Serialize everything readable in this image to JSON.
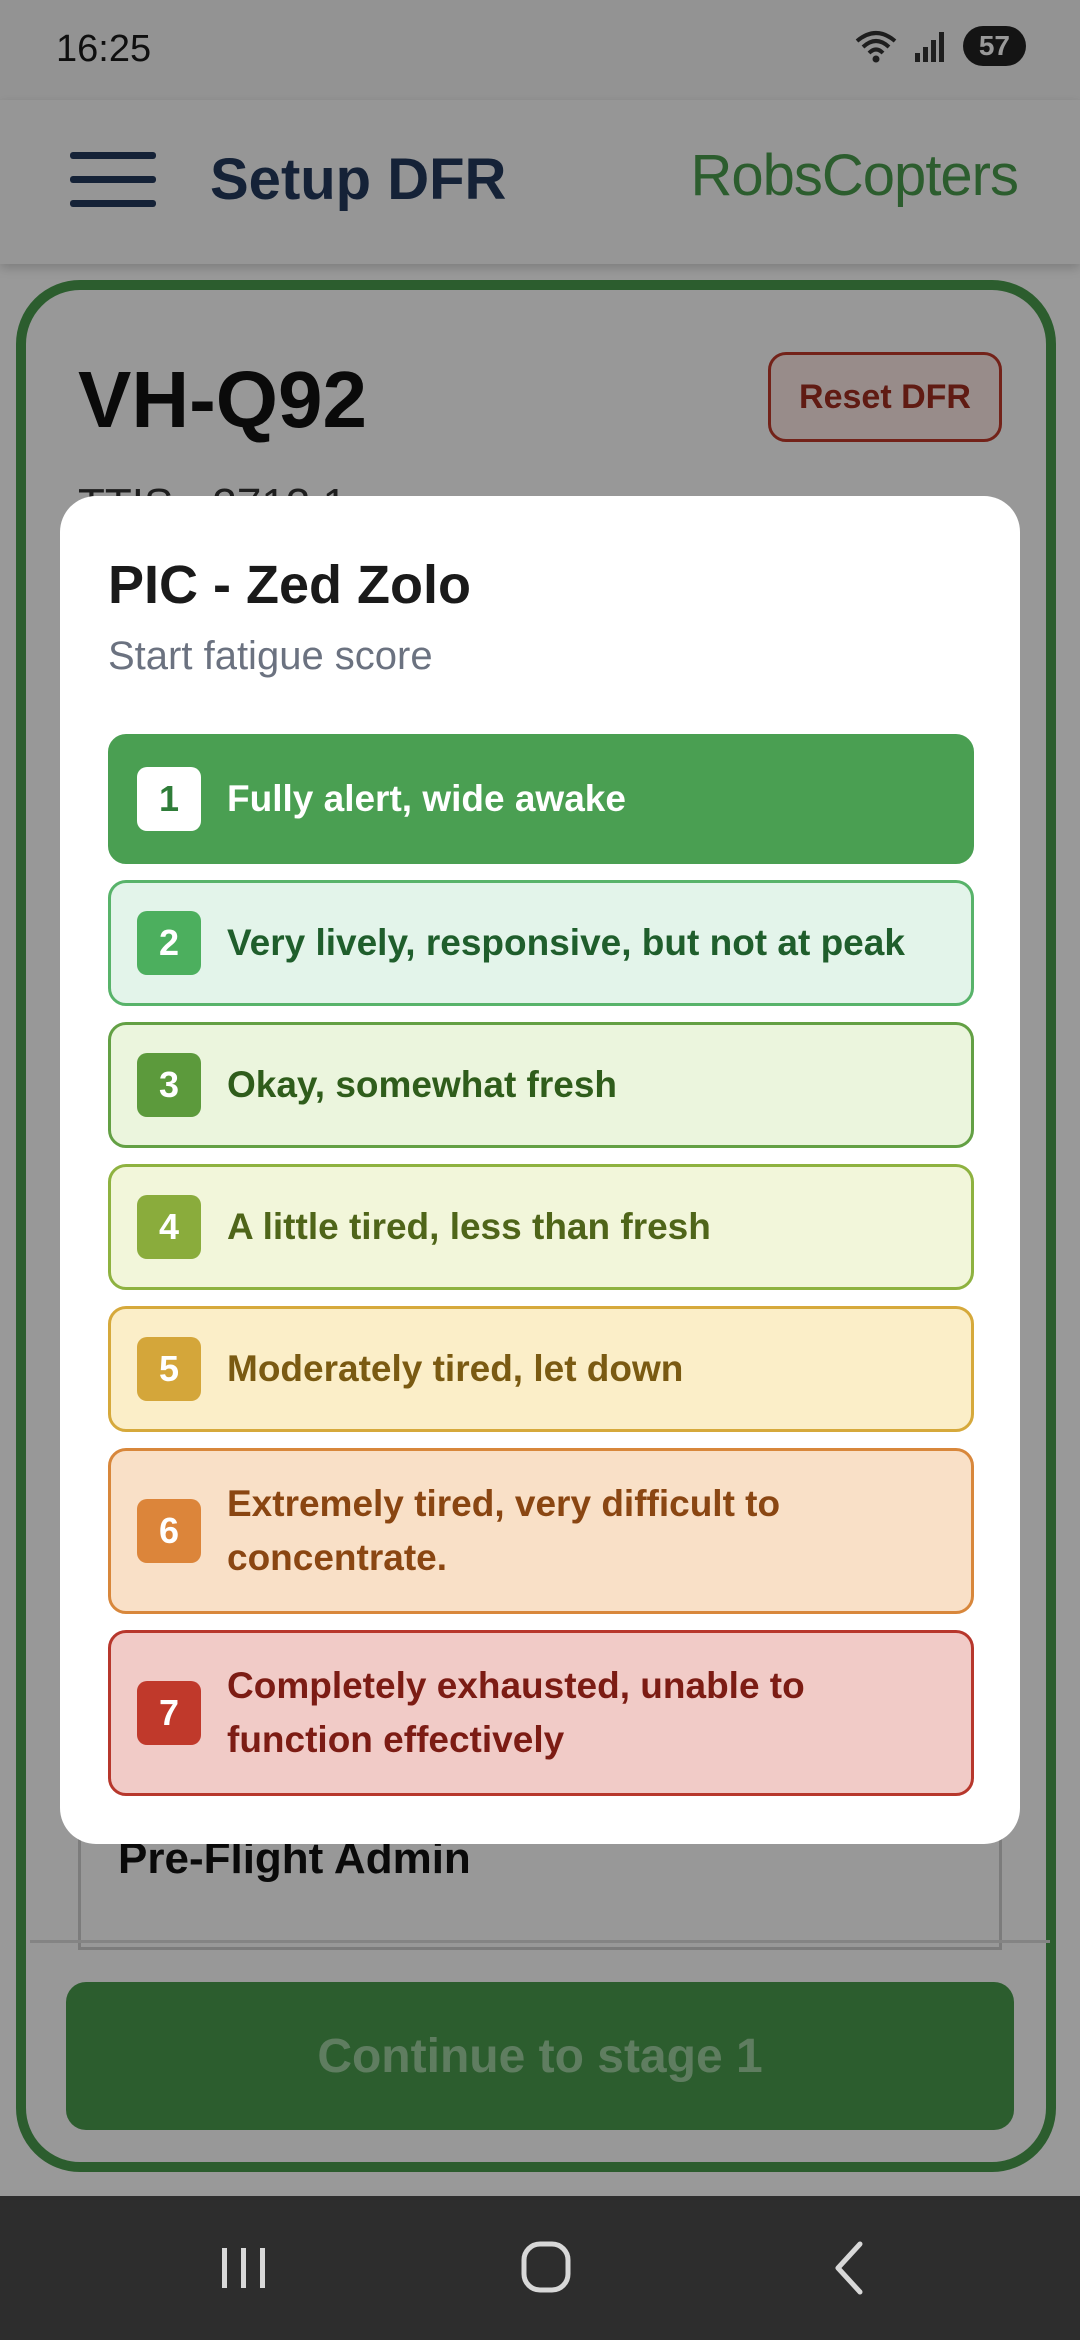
{
  "status_bar": {
    "time": "16:25",
    "battery": "57",
    "icons": [
      "wifi-icon",
      "signal-icon",
      "battery-icon"
    ]
  },
  "app_bar": {
    "title": "Setup DFR",
    "brand": "RobsCopters",
    "menu_icon": "hamburger-menu-icon"
  },
  "aircraft": {
    "registration": "VH-Q92",
    "sub_line": "TTIS - 3713.1",
    "reset_label": "Reset DFR"
  },
  "section": {
    "title": "Pre-Flight Admin"
  },
  "footer": {
    "continue_label": "Continue to stage 1"
  },
  "modal": {
    "title": "PIC - Zed Zolo",
    "subtitle": "Start fatigue score",
    "options": [
      {
        "score": "1",
        "label": "Fully alert, wide awake",
        "selected": true,
        "color": "#4a9f52"
      },
      {
        "score": "2",
        "label": "Very lively, responsive, but not at peak",
        "color": "#4caf5e"
      },
      {
        "score": "3",
        "label": "Okay, somewhat fresh",
        "color": "#5c9a3c"
      },
      {
        "score": "4",
        "label": "A little tired, less than fresh",
        "color": "#8aac3c"
      },
      {
        "score": "5",
        "label": "Moderately tired, let down",
        "color": "#d4a63a"
      },
      {
        "score": "6",
        "label": "Extremely tired, very difficult to concentrate.",
        "color": "#dc853a"
      },
      {
        "score": "7",
        "label": "Completely exhausted, unable to function effectively",
        "color": "#c0392b"
      }
    ]
  },
  "nav_bar": {
    "buttons": [
      "recent-apps-icon",
      "home-icon",
      "back-icon"
    ]
  },
  "colors": {
    "brand_green": "#4a9b4e",
    "title_navy": "#23395d"
  }
}
